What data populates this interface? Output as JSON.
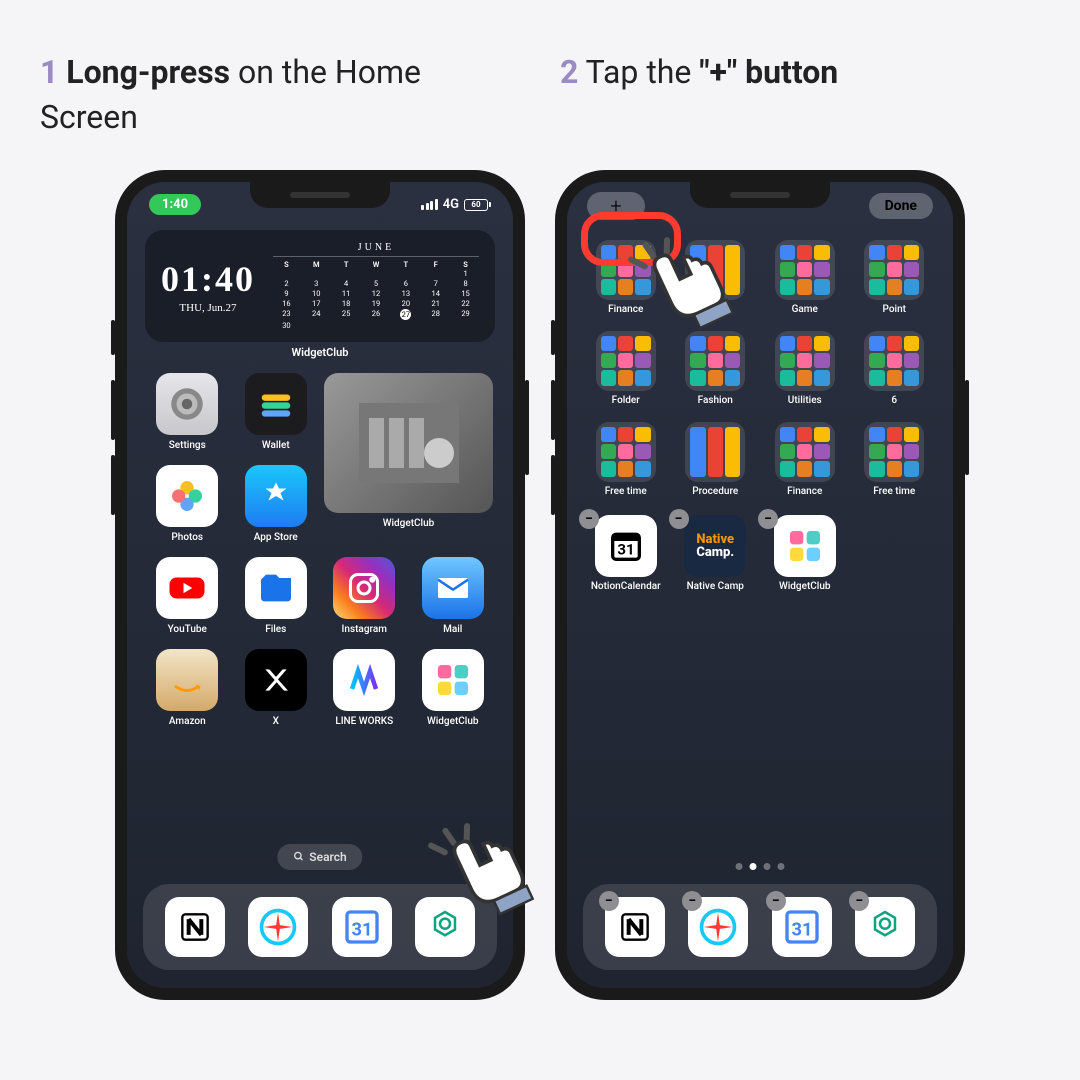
{
  "step1": {
    "num": "1",
    "bold": "Long-press",
    "rest": " on the Home Screen"
  },
  "step2": {
    "num": "2",
    "pre": "Tap the ",
    "bold": "\"+\" button"
  },
  "phone1": {
    "time": "1:40",
    "network": "4G",
    "battery": "60",
    "widget": {
      "time": "01:40",
      "date": "THU, Jun.27",
      "month": "JUNE",
      "dow": [
        "S",
        "M",
        "T",
        "W",
        "T",
        "F",
        "S"
      ],
      "days": [
        "",
        "",
        "",
        "",
        "",
        "",
        "1",
        "2",
        "3",
        "4",
        "5",
        "6",
        "7",
        "8",
        "9",
        "10",
        "11",
        "12",
        "13",
        "14",
        "15",
        "16",
        "17",
        "18",
        "19",
        "20",
        "21",
        "22",
        "23",
        "24",
        "25",
        "26",
        "27",
        "28",
        "29",
        "30"
      ],
      "today": "27",
      "label": "WidgetClub"
    },
    "apps_row1": [
      {
        "label": "Settings",
        "cls": "ic-settings"
      },
      {
        "label": "Wallet",
        "cls": "ic-wallet"
      }
    ],
    "big_widget_label": "WidgetClub",
    "apps_row2": [
      {
        "label": "Photos",
        "cls": "ic-photos"
      },
      {
        "label": "App Store",
        "cls": "ic-appstore"
      }
    ],
    "apps_row3": [
      {
        "label": "YouTube",
        "cls": "ic-youtube"
      },
      {
        "label": "Files",
        "cls": "ic-files"
      },
      {
        "label": "Instagram",
        "cls": "ic-instagram"
      },
      {
        "label": "Mail",
        "cls": "ic-mail"
      }
    ],
    "apps_row4": [
      {
        "label": "Amazon",
        "cls": "ic-amazon"
      },
      {
        "label": "X",
        "cls": "ic-x"
      },
      {
        "label": "LINE WORKS",
        "cls": "ic-lineworks"
      },
      {
        "label": "WidgetClub",
        "cls": "ic-widgetclub"
      }
    ],
    "search": "Search",
    "dock": [
      {
        "cls": "ic-notion"
      },
      {
        "cls": "ic-safari"
      },
      {
        "cls": "ic-gcal"
      },
      {
        "cls": "ic-chatgpt"
      }
    ]
  },
  "phone2": {
    "plus": "+",
    "done": "Done",
    "folders_r1": [
      {
        "label": "Finance"
      },
      {
        "label": ""
      },
      {
        "label": "Game"
      },
      {
        "label": "Point"
      }
    ],
    "folders_r2": [
      {
        "label": "Folder"
      },
      {
        "label": "Fashion"
      },
      {
        "label": "Utilities"
      },
      {
        "label": "6"
      }
    ],
    "folders_r3": [
      {
        "label": "Free time"
      },
      {
        "label": "Procedure"
      },
      {
        "label": "Finance"
      },
      {
        "label": "Free time"
      }
    ],
    "big_apps": [
      {
        "label": "NotionCalendar",
        "cls": "ic-notioncal"
      },
      {
        "label": "Native Camp",
        "cls": "ic-nativecamp"
      },
      {
        "label": "WidgetClub",
        "cls": "ic-widgetclub"
      }
    ],
    "dock": [
      {
        "cls": "ic-notion"
      },
      {
        "cls": "ic-safari"
      },
      {
        "cls": "ic-gcal"
      },
      {
        "cls": "ic-chatgpt"
      }
    ]
  }
}
